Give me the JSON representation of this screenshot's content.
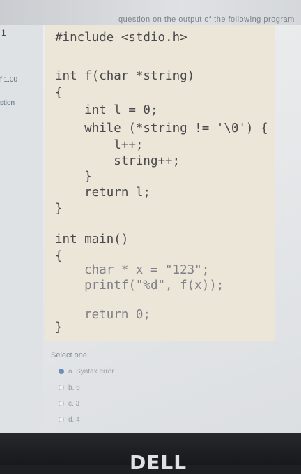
{
  "header": {
    "partial_text": "question on the output of the following program"
  },
  "sidebar": {
    "top": "1",
    "mark": "f 1.00",
    "question": "stion"
  },
  "code": {
    "lines": [
      "#include <stdio.h>",
      "",
      "int f(char *string)",
      "{",
      "    int l = 0;",
      "    while (*string != '\\0') {",
      "        l++;",
      "        string++;",
      "    }",
      "    return l;",
      "}",
      "",
      "int main()",
      "{",
      "    char * x = \"123\";",
      "    printf(\"%d\", f(x));",
      "",
      "    return 0;",
      "}"
    ]
  },
  "answer": {
    "label": "Select one:",
    "options": [
      {
        "text": "a. Syntax error",
        "selected": true
      },
      {
        "text": "b. 6",
        "selected": false
      },
      {
        "text": "c. 3",
        "selected": false
      },
      {
        "text": "d. 4",
        "selected": false
      }
    ]
  },
  "monitor": {
    "brand": "DELL"
  },
  "colors": {
    "code_bg": "#ece6d8",
    "radio_selected": "#6c8fb8"
  }
}
